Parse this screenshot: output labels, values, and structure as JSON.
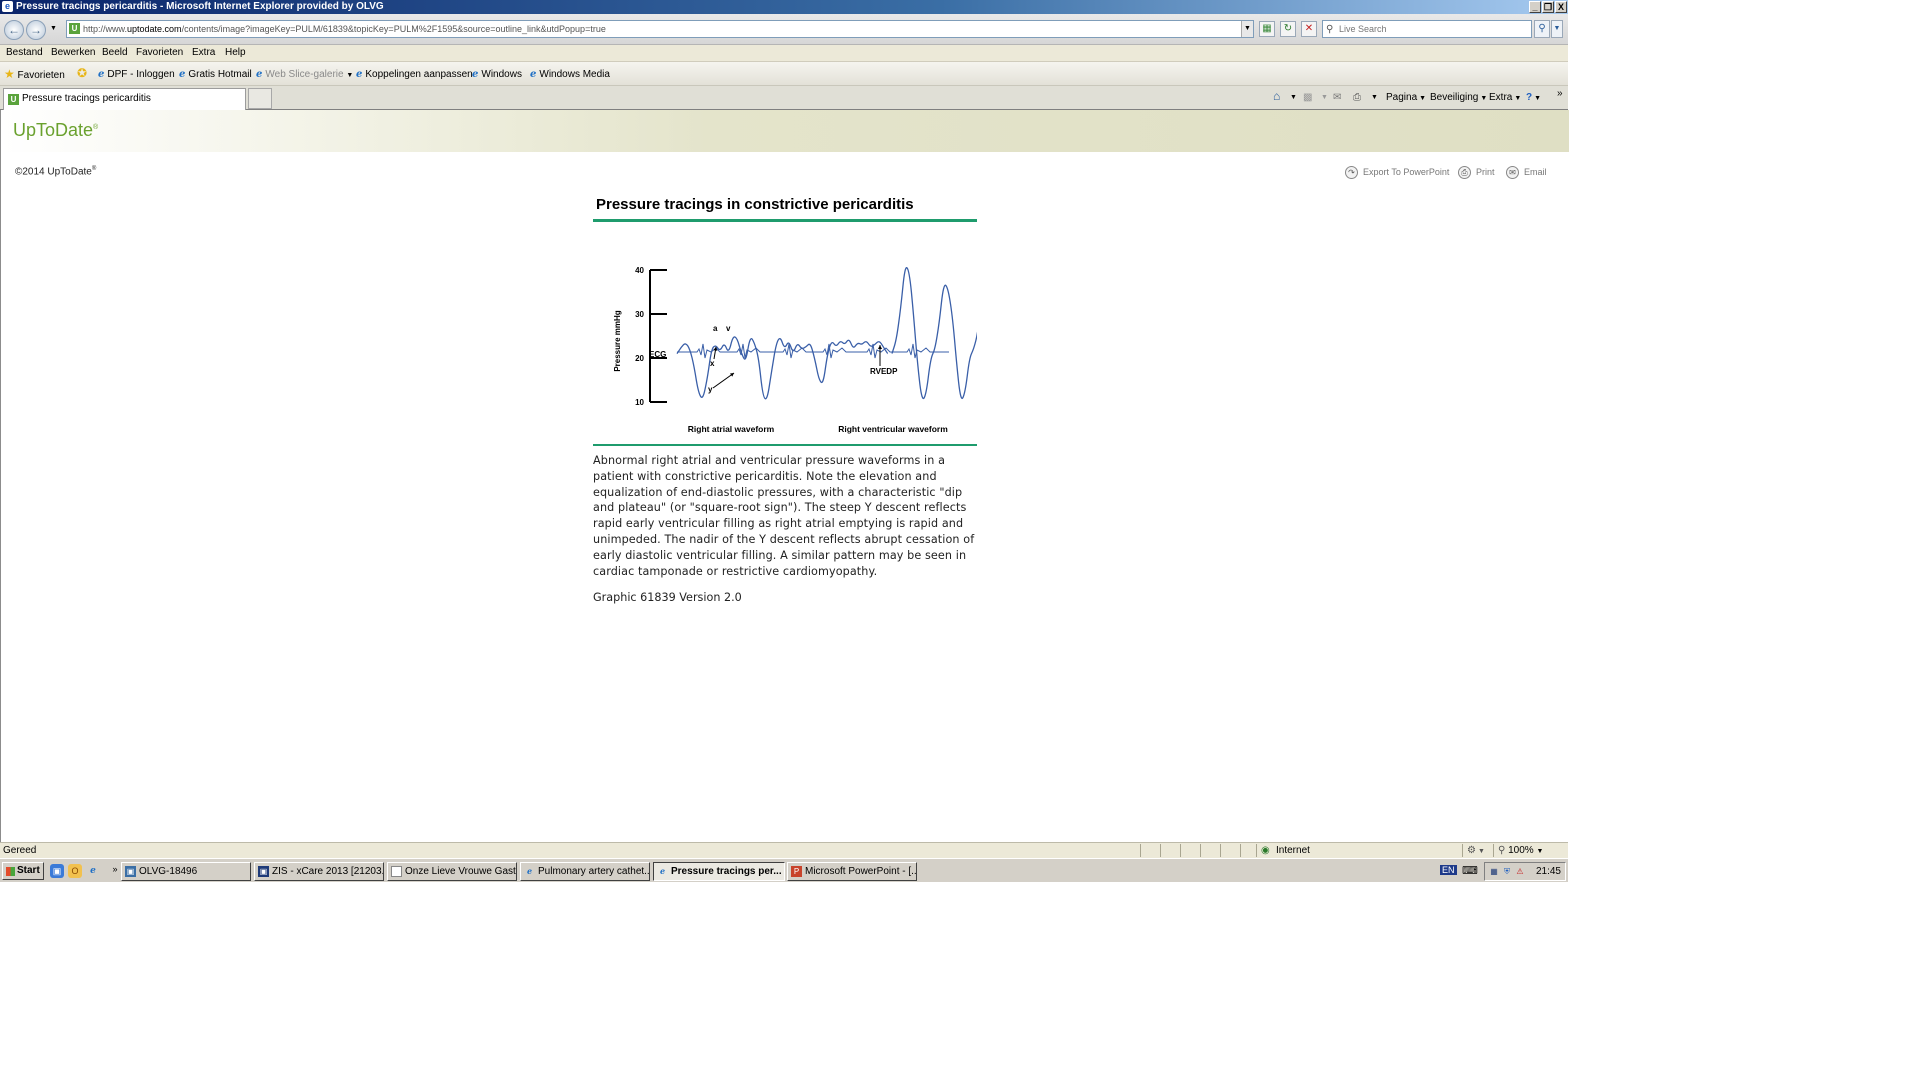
{
  "window": {
    "title": "Pressure tracings pericarditis - Microsoft Internet Explorer provided by OLVG",
    "controls": [
      "_",
      "❐",
      "X"
    ]
  },
  "address": {
    "url_prefix": "http://www.",
    "url_domain": "uptodate.com",
    "url_path": "/contents/image?imageKey=PULM/61839&topicKey=PULM%2F1595&source=outline_link&utdPopup=true",
    "search_placeholder": "Live Search"
  },
  "menu": [
    "Bestand",
    "Bewerken",
    "Beeld",
    "Favorieten",
    "Extra",
    "Help"
  ],
  "favorites": {
    "label": "Favorieten",
    "items": [
      "DPF - Inloggen",
      "Gratis Hotmail",
      "Web Slice-galerie",
      "Koppelingen aanpassen",
      "Windows",
      "Windows Media"
    ]
  },
  "tab": {
    "title": "Pressure tracings pericarditis"
  },
  "commandbar": {
    "pagina": "Pagina",
    "beveiliging": "Beveiliging",
    "extra": "Extra",
    "more": "»"
  },
  "page": {
    "brand": "UpToDate",
    "brand_mark": "®",
    "copyright": "©2014 UpToDate",
    "copyright_mark": "®",
    "actions": [
      "Export To PowerPoint",
      "Print",
      "Email"
    ],
    "figure_title": "Pressure tracings in constrictive pericarditis",
    "caption": "Abnormal right atrial and ventricular pressure waveforms in a patient with constrictive pericarditis. Note the elevation and equalization of end-diastolic pressures, with a characteristic \"dip and plateau\" (or \"square-root sign\"). The steep Y descent reflects rapid early ventricular filling as right atrial emptying is rapid and unimpeded. The nadir of the Y descent reflects abrupt cessation of early diastolic ventricular filling. A similar pattern may be seen in cardiac tamponade or restrictive cardiomyopathy.",
    "graphic_id": "Graphic 61839 Version 2.0"
  },
  "chart_data": {
    "type": "line",
    "title": "Pressure tracings in constrictive pericarditis",
    "ecg_label": "ECG",
    "ylabel": "Pressure mmHg",
    "ylim": [
      10,
      40
    ],
    "yticks": [
      10,
      20,
      30,
      40
    ],
    "xlabels": [
      "Right atrial waveform",
      "Right ventricular waveform"
    ],
    "annotations": [
      "a",
      "v",
      "x",
      "y",
      "RVEDP"
    ],
    "grid": false,
    "series": [
      {
        "name": "Right atrial waveform",
        "x": [
          0,
          1,
          2,
          3,
          4,
          5,
          6,
          7,
          8,
          9,
          10,
          11,
          12,
          13,
          14,
          15,
          16,
          17,
          18,
          19,
          20,
          21,
          22,
          23,
          24,
          25,
          26,
          27,
          28,
          29,
          30,
          31,
          32,
          33,
          34,
          35,
          36,
          37,
          38,
          39,
          40,
          41,
          42,
          43,
          44,
          45,
          46,
          47,
          48,
          49
        ],
        "values": [
          21,
          22.5,
          23.5,
          22,
          18,
          12,
          10.5,
          15,
          22,
          23,
          21.5,
          23.5,
          21,
          25,
          24.5,
          21,
          19,
          25,
          23.5,
          20,
          11,
          10.5,
          17,
          23,
          25,
          22,
          24,
          21,
          23.5,
          22,
          22.5,
          23.5,
          20,
          15,
          14,
          21,
          24,
          22.5,
          24,
          23,
          24.5,
          22,
          23.5,
          23,
          24,
          22.5,
          23,
          24,
          22.5,
          21
        ]
      },
      {
        "name": "Right ventricular waveform",
        "x": [
          50,
          51,
          52,
          53,
          54,
          55,
          56,
          57,
          58,
          59,
          60,
          61,
          62,
          63,
          64,
          65,
          66,
          67,
          68,
          69,
          70,
          71,
          72,
          73,
          74,
          75,
          76,
          77,
          78,
          79,
          80,
          81,
          82,
          83
        ],
        "values": [
          21,
          24,
          31,
          41,
          40,
          30,
          18,
          10,
          12,
          20,
          22,
          28,
          37,
          36,
          30,
          19,
          10,
          12,
          20,
          22,
          26,
          34,
          38.5,
          37,
          30,
          20,
          11,
          10.2,
          14,
          21,
          22,
          24,
          35,
          38
        ]
      }
    ]
  },
  "status": {
    "text": "Gereed",
    "zone": "Internet",
    "zoom": "100%"
  },
  "taskbar": {
    "start": "Start",
    "more": "»",
    "buttons": [
      "OLVG-18496",
      "ZIS - xCare 2013 [21203...",
      "Onze Lieve Vrouwe Gast...",
      "Pulmonary artery cathet...",
      "Pressure tracings per...",
      "Microsoft PowerPoint - [..."
    ],
    "lang": "EN",
    "clock": "21:45"
  }
}
